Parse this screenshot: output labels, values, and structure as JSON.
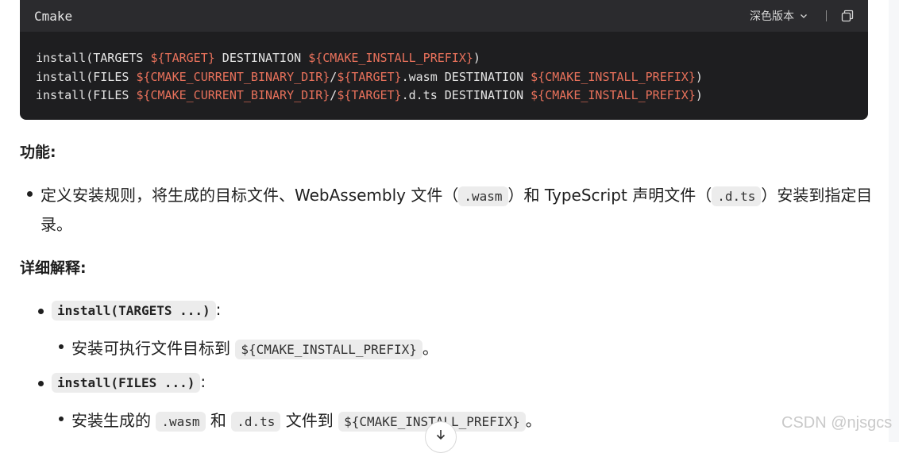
{
  "code_block": {
    "language": "Cmake",
    "theme_label": "深色版本",
    "lines": [
      [
        {
          "t": "install(TARGETS ",
          "v": false
        },
        {
          "t": "${TARGET}",
          "v": true
        },
        {
          "t": " DESTINATION ",
          "v": false
        },
        {
          "t": "${CMAKE_INSTALL_PREFIX}",
          "v": true
        },
        {
          "t": ")",
          "v": false
        }
      ],
      [
        {
          "t": "install(FILES ",
          "v": false
        },
        {
          "t": "${CMAKE_CURRENT_BINARY_DIR}",
          "v": true
        },
        {
          "t": "/",
          "v": false
        },
        {
          "t": "${TARGET}",
          "v": true
        },
        {
          "t": ".wasm DESTINATION ",
          "v": false
        },
        {
          "t": "${CMAKE_INSTALL_PREFIX}",
          "v": true
        },
        {
          "t": ")",
          "v": false
        }
      ],
      [
        {
          "t": "install(FILES ",
          "v": false
        },
        {
          "t": "${CMAKE_CURRENT_BINARY_DIR}",
          "v": true
        },
        {
          "t": "/",
          "v": false
        },
        {
          "t": "${TARGET}",
          "v": true
        },
        {
          "t": ".d.ts DESTINATION ",
          "v": false
        },
        {
          "t": "${CMAKE_INSTALL_PREFIX}",
          "v": true
        },
        {
          "t": ")",
          "v": false
        }
      ]
    ]
  },
  "section_function": {
    "heading": "功能:",
    "line1_part1": "定义安装规则，将生成的目标文件、WebAssembly 文件（",
    "line1_code1": ".wasm",
    "line1_part2": "）和 TypeScript 声明文件（",
    "line1_code2": ".d.ts",
    "line1_part3": "）安装到指定目",
    "line2": "录。"
  },
  "section_detail": {
    "heading": "详细解释:",
    "item1_code": "install(TARGETS ...)",
    "item1_colon": ":",
    "item1_sub_text": "安装可执行文件目标到",
    "item1_sub_code": "${CMAKE_INSTALL_PREFIX}",
    "item1_sub_end": "。",
    "item2_code": "install(FILES ...)",
    "item2_colon": ":",
    "item2_sub_text1": "安装生成的",
    "item2_sub_code1": ".wasm",
    "item2_sub_text2": "和",
    "item2_sub_code2": ".d.ts",
    "item2_sub_text3": "文件到",
    "item2_sub_code3": "${CMAKE_INSTALL_PREFIX}",
    "item2_sub_end": "。"
  },
  "watermark": "CSDN @njsgcs",
  "icons": {
    "theme_dropdown": "chevron-down-icon",
    "copy": "copy-icon",
    "scroll": "arrow-down-icon"
  },
  "colors": {
    "code_bg": "#1e1e20",
    "code_header_bg": "#2b2b2e",
    "code_variable": "#e8715b"
  }
}
